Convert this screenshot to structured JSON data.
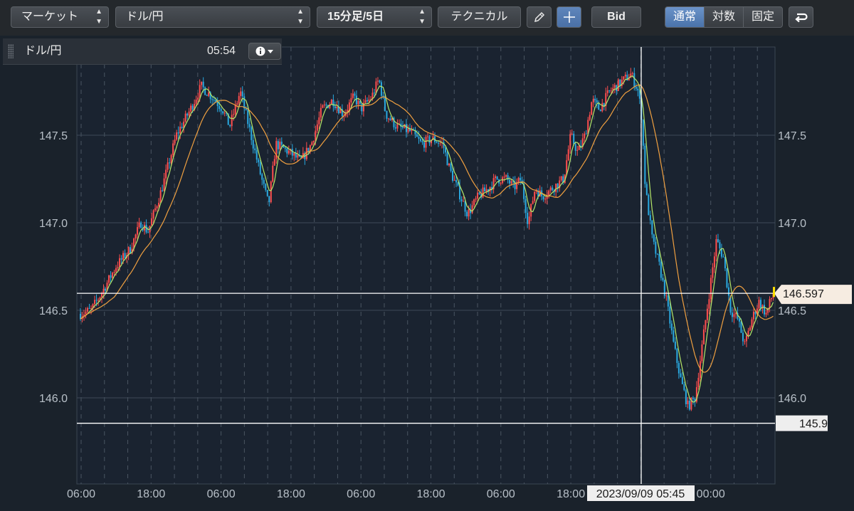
{
  "toolbar": {
    "market": "マーケット",
    "pair": "ドル/円",
    "period": "15分足/5日",
    "technical": "テクニカル",
    "bid": "Bid",
    "scale_normal": "通常",
    "scale_log": "対数",
    "scale_fixed": "固定"
  },
  "header": {
    "symbol": "ドル/円",
    "time": "05:54"
  },
  "chart_data": {
    "type": "candlestick",
    "ylim": [
      145.5,
      148.0
    ],
    "y_ticks": [
      "147.5",
      "147.0",
      "146.5",
      "146.0"
    ],
    "x_ticks": [
      "06:00",
      "18:00",
      "06:00",
      "18:00",
      "06:00",
      "18:00",
      "06:00",
      "18:00",
      "06:00",
      "00:00"
    ],
    "crosshair_label": "2023/09/09 05:45",
    "current_price_label": "146.597",
    "current_price": 146.597,
    "horizontal_line_label": "145.9",
    "horizontal_line": 145.855,
    "grid": true,
    "colors": {
      "up": "#ff4e4e",
      "down": "#2aa9e0",
      "ma_short": "#b5e86a",
      "ma_long": "#f0a040"
    },
    "path_anchors": [
      [
        0,
        146.48
      ],
      [
        15,
        146.5
      ],
      [
        30,
        146.6
      ],
      [
        50,
        146.75
      ],
      [
        70,
        146.85
      ],
      [
        85,
        147.0
      ],
      [
        95,
        146.95
      ],
      [
        115,
        147.2
      ],
      [
        135,
        147.5
      ],
      [
        155,
        147.65
      ],
      [
        170,
        147.78
      ],
      [
        185,
        147.72
      ],
      [
        200,
        147.65
      ],
      [
        210,
        147.55
      ],
      [
        225,
        147.75
      ],
      [
        240,
        147.5
      ],
      [
        255,
        147.25
      ],
      [
        265,
        147.1
      ],
      [
        275,
        147.45
      ],
      [
        295,
        147.4
      ],
      [
        310,
        147.35
      ],
      [
        325,
        147.45
      ],
      [
        340,
        147.65
      ],
      [
        355,
        147.7
      ],
      [
        370,
        147.62
      ],
      [
        385,
        147.72
      ],
      [
        395,
        147.65
      ],
      [
        410,
        147.72
      ],
      [
        420,
        147.82
      ],
      [
        430,
        147.62
      ],
      [
        445,
        147.55
      ],
      [
        465,
        147.52
      ],
      [
        480,
        147.45
      ],
      [
        495,
        147.48
      ],
      [
        510,
        147.45
      ],
      [
        520,
        147.3
      ],
      [
        530,
        147.2
      ],
      [
        545,
        147.05
      ],
      [
        560,
        147.15
      ],
      [
        575,
        147.2
      ],
      [
        585,
        147.25
      ],
      [
        600,
        147.25
      ],
      [
        610,
        147.2
      ],
      [
        620,
        147.25
      ],
      [
        630,
        147.0
      ],
      [
        640,
        147.2
      ],
      [
        650,
        147.15
      ],
      [
        665,
        147.2
      ],
      [
        680,
        147.25
      ],
      [
        690,
        147.5
      ],
      [
        700,
        147.4
      ],
      [
        710,
        147.5
      ],
      [
        720,
        147.7
      ],
      [
        730,
        147.65
      ],
      [
        745,
        147.75
      ],
      [
        760,
        147.8
      ],
      [
        775,
        147.85
      ],
      [
        785,
        147.75
      ],
      [
        790,
        147.6
      ],
      [
        795,
        147.2
      ],
      [
        805,
        146.9
      ],
      [
        815,
        146.75
      ],
      [
        825,
        146.55
      ],
      [
        835,
        146.3
      ],
      [
        845,
        146.1
      ],
      [
        855,
        145.95
      ],
      [
        865,
        146.0
      ],
      [
        875,
        146.3
      ],
      [
        885,
        146.6
      ],
      [
        895,
        146.9
      ],
      [
        905,
        146.8
      ],
      [
        915,
        146.5
      ],
      [
        925,
        146.45
      ],
      [
        935,
        146.3
      ],
      [
        945,
        146.45
      ],
      [
        955,
        146.55
      ],
      [
        965,
        146.48
      ],
      [
        975,
        146.6
      ]
    ]
  }
}
